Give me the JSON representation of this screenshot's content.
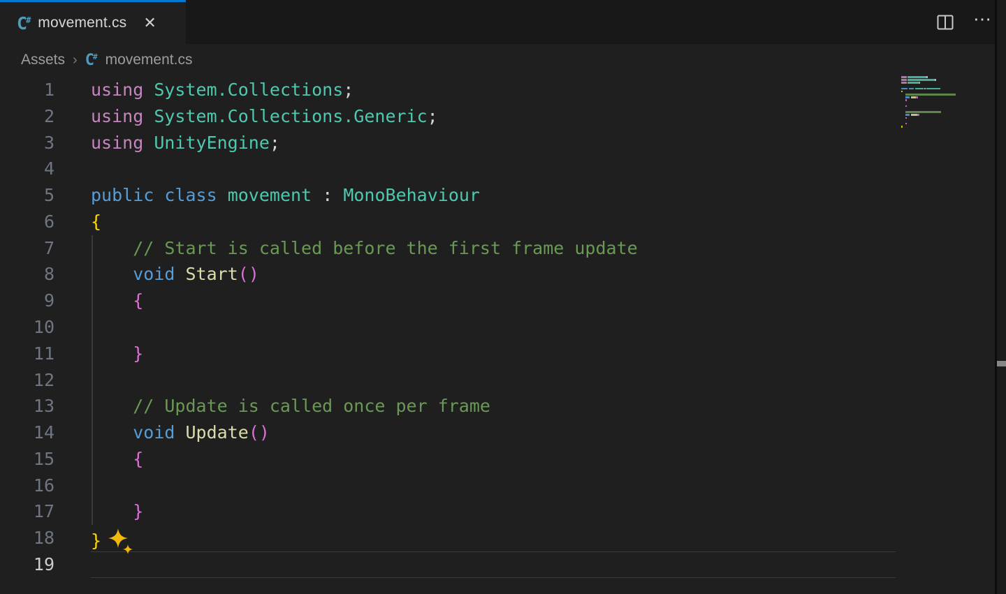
{
  "tab_bar": {
    "tab": {
      "label": "movement.cs",
      "icon": "csharp-file-icon",
      "close_label": "✕",
      "active": true
    },
    "actions": {
      "split_editor": "split-editor",
      "more_actions": "⋯"
    }
  },
  "breadcrumb": {
    "folder": "Assets",
    "separator": "›",
    "file": "movement.cs"
  },
  "colors": {
    "accent": "#0078d4",
    "editor_bg": "#1f1f1f",
    "tabbar_bg": "#181818",
    "csharp_icon": "#519aba",
    "line_number": "#6e7681",
    "line_number_active": "#cccccc",
    "sparkle": "#f2b90d"
  },
  "editor": {
    "language": "csharp",
    "active_line": 19,
    "total_lines": 19,
    "palette": {
      "p": "#C586C0",
      "t": "#4EC9B0",
      "b": "#569CD6",
      "m": "#DCDCAA",
      "c": "#6A9955",
      "g1": "#FFD700",
      "g2": "#DA70D6",
      "w": "#D4D4D4"
    },
    "lines": [
      {
        "n": 1,
        "tokens": [
          [
            "using",
            "p"
          ],
          [
            " ",
            "w"
          ],
          [
            "System.Collections",
            "t"
          ],
          [
            ";",
            "w"
          ]
        ]
      },
      {
        "n": 2,
        "tokens": [
          [
            "using",
            "p"
          ],
          [
            " ",
            "w"
          ],
          [
            "System.Collections.Generic",
            "t"
          ],
          [
            ";",
            "w"
          ]
        ]
      },
      {
        "n": 3,
        "tokens": [
          [
            "using",
            "p"
          ],
          [
            " ",
            "w"
          ],
          [
            "UnityEngine",
            "t"
          ],
          [
            ";",
            "w"
          ]
        ]
      },
      {
        "n": 4,
        "tokens": []
      },
      {
        "n": 5,
        "tokens": [
          [
            "public",
            "b"
          ],
          [
            " ",
            "w"
          ],
          [
            "class",
            "b"
          ],
          [
            " ",
            "w"
          ],
          [
            "movement",
            "t"
          ],
          [
            " ",
            "w"
          ],
          [
            ":",
            "w"
          ],
          [
            " ",
            "w"
          ],
          [
            "MonoBehaviour",
            "t"
          ]
        ]
      },
      {
        "n": 6,
        "tokens": [
          [
            "{",
            "g1"
          ]
        ]
      },
      {
        "n": 7,
        "tokens": [
          [
            "    ",
            "w"
          ],
          [
            "// Start is called before the first frame update",
            "c"
          ]
        ]
      },
      {
        "n": 8,
        "tokens": [
          [
            "    ",
            "w"
          ],
          [
            "void",
            "b"
          ],
          [
            " ",
            "w"
          ],
          [
            "Start",
            "m"
          ],
          [
            "()",
            "g2"
          ]
        ]
      },
      {
        "n": 9,
        "tokens": [
          [
            "    ",
            "w"
          ],
          [
            "{",
            "g2"
          ]
        ]
      },
      {
        "n": 10,
        "tokens": []
      },
      {
        "n": 11,
        "tokens": [
          [
            "    ",
            "w"
          ],
          [
            "}",
            "g2"
          ]
        ]
      },
      {
        "n": 12,
        "tokens": []
      },
      {
        "n": 13,
        "tokens": [
          [
            "    ",
            "w"
          ],
          [
            "// Update is called once per frame",
            "c"
          ]
        ]
      },
      {
        "n": 14,
        "tokens": [
          [
            "    ",
            "w"
          ],
          [
            "void",
            "b"
          ],
          [
            " ",
            "w"
          ],
          [
            "Update",
            "m"
          ],
          [
            "()",
            "g2"
          ]
        ]
      },
      {
        "n": 15,
        "tokens": [
          [
            "    ",
            "w"
          ],
          [
            "{",
            "g2"
          ]
        ]
      },
      {
        "n": 16,
        "tokens": []
      },
      {
        "n": 17,
        "tokens": [
          [
            "    ",
            "w"
          ],
          [
            "}",
            "g2"
          ]
        ]
      },
      {
        "n": 18,
        "tokens": [
          [
            "}",
            "g1"
          ]
        ],
        "sparkle": true
      },
      {
        "n": 19,
        "tokens": []
      }
    ],
    "indent_guide": {
      "from_line": 7,
      "to_line": 17
    }
  }
}
